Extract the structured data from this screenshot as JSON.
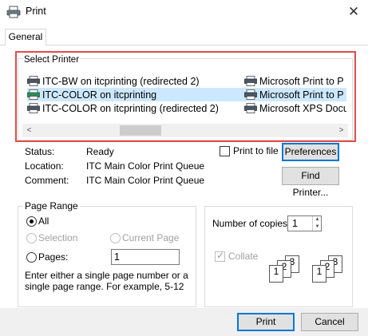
{
  "window": {
    "title": "Print",
    "close_glyph": "✕",
    "icon": "printer-icon"
  },
  "tabs": [
    {
      "label": "General",
      "active": true
    }
  ],
  "select_printer": {
    "label": "Select Printer",
    "left_column": [
      {
        "label": "ITC-BW on itcprinting (redirected 2)",
        "selected": false
      },
      {
        "label": "ITC-COLOR on itcprinting",
        "selected": true
      },
      {
        "label": "ITC-COLOR on itcprinting (redirected 2)",
        "selected": false
      }
    ],
    "right_column": [
      {
        "label": "Microsoft Print to P"
      },
      {
        "label": "Microsoft Print to P"
      },
      {
        "label": "Microsoft XPS Docu"
      }
    ],
    "scroll_left_glyph": "<",
    "scroll_right_glyph": ">",
    "highlight_color": "#e24b4b"
  },
  "printer_info": {
    "status_label": "Status:",
    "status_value": "Ready",
    "location_label": "Location:",
    "location_value": "ITC Main Color Print Queue",
    "comment_label": "Comment:",
    "comment_value": "ITC Main Color Print Queue"
  },
  "print_to_file": {
    "label": "Print to file",
    "checked": false
  },
  "buttons": {
    "preferences": "Preferences",
    "find_printer": "Find Printer...",
    "print": "Print",
    "cancel": "Cancel"
  },
  "page_range": {
    "label": "Page Range",
    "all": "All",
    "selection": "Selection",
    "current_page": "Current Page",
    "pages": "Pages:",
    "pages_value": "1",
    "hint": "Enter either a single page number or a single page range.  For example, 5-12"
  },
  "copies": {
    "label": "Number of copies:",
    "value": "1",
    "collate": "Collate",
    "collate_checked": true,
    "collate_pages": [
      "1",
      "2",
      "3"
    ]
  }
}
